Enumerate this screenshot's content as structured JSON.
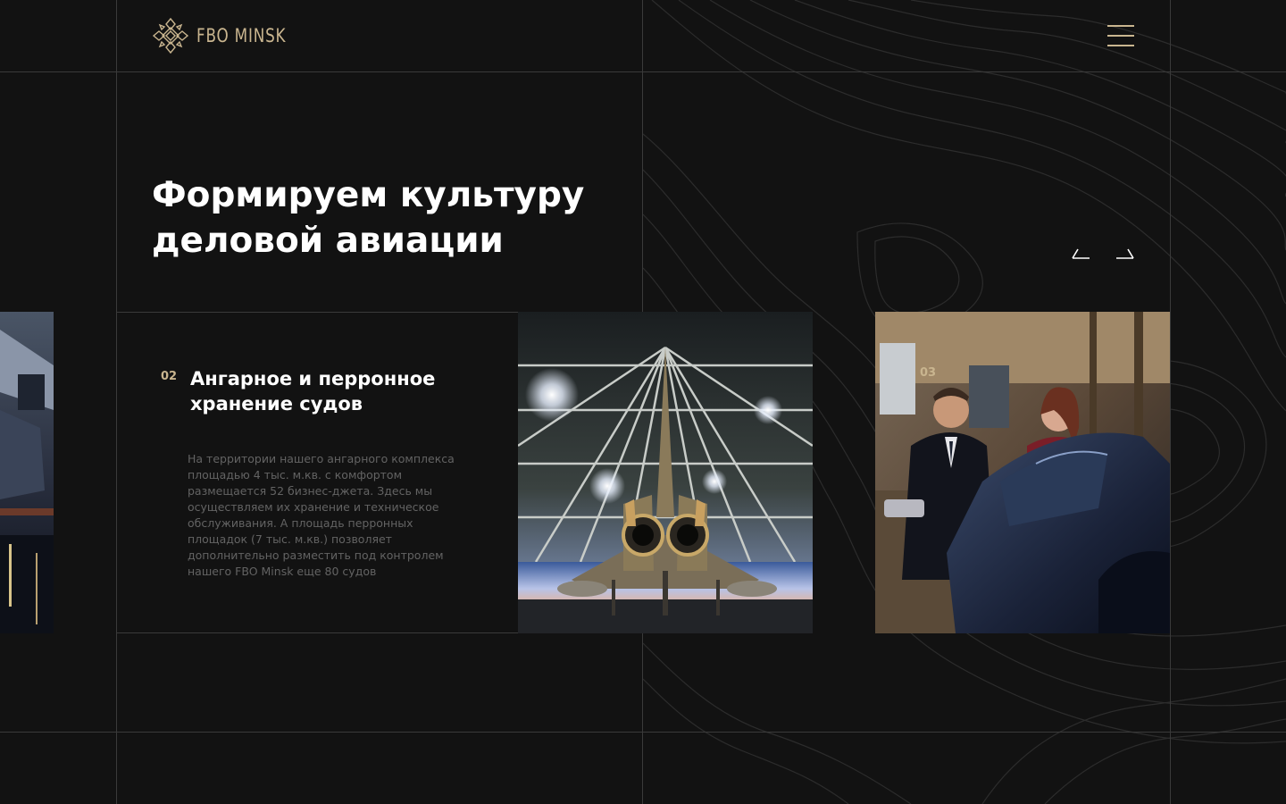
{
  "header": {
    "logo_text": "FBO MINSK",
    "menu_icon": "hamburger-icon"
  },
  "hero": {
    "title_line1": "Формируем культуру",
    "title_line2": "деловой авиации"
  },
  "slider": {
    "prev_icon": "arrow-left-icon",
    "next_icon": "arrow-right-icon",
    "active": {
      "number": "02",
      "title_line1": "Ангарное и перронное",
      "title_line2": "хранение судов",
      "text": [
        "На территории нашего ангарного комплекса",
        "площадью 4 тыс. м.кв. с комфортом",
        "размещается 52 бизнес-джета. Здесь мы",
        "осуществляем их хранение и техническое",
        "обслуживания. А площадь перронных",
        "площадок (7 тыс. м.кв.) позволяет",
        "дополнительно разместить под контролем",
        "нашего FBO Minsk еще 80 судов"
      ]
    },
    "next": {
      "number": "03"
    }
  },
  "colors": {
    "background": "#121212",
    "gold": "#c9b58f",
    "grid_line": "#3a3a3a",
    "text_muted": "#636363"
  }
}
